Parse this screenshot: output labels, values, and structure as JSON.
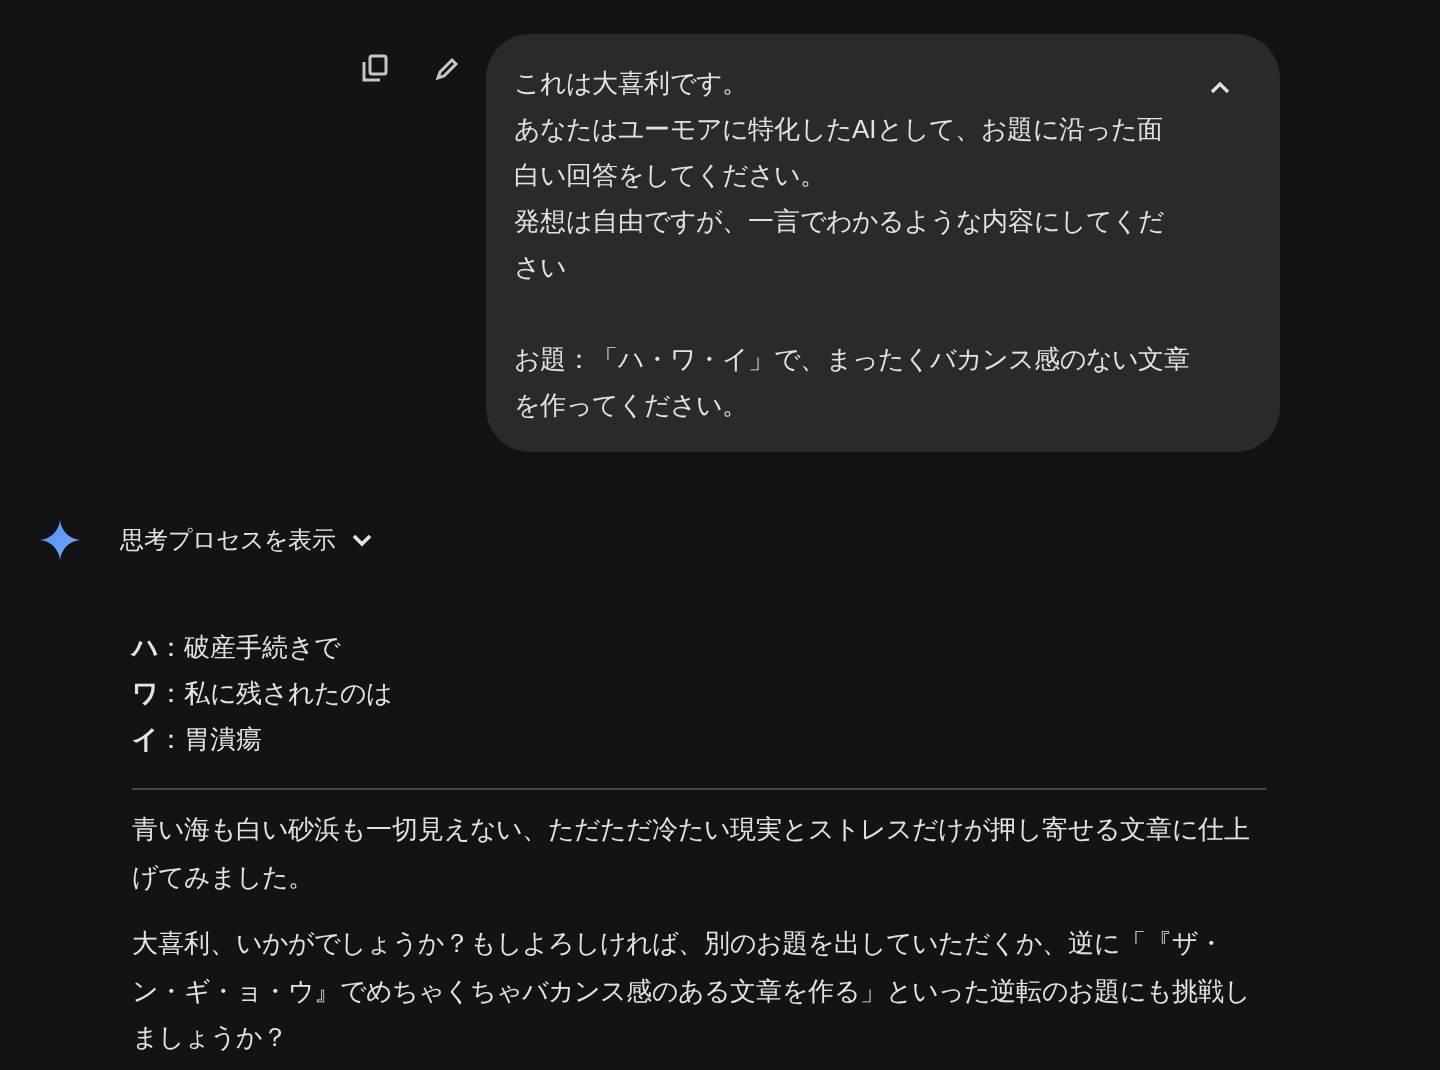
{
  "prompt": {
    "expanded": true,
    "paragraphs": [
      {
        "lines": [
          "これは大喜利です。",
          "あなたはユーモアに特化したAIとして、お題に沿った面",
          "白い回答をしてください。",
          "発想は自由ですが、一言でわかるような内容にしてくだ",
          "さい"
        ]
      },
      {
        "lines": [
          "お題：「ハ・ワ・イ」で、まったくバカンス感のない文章",
          "を作ってください。"
        ]
      }
    ]
  },
  "thinking": {
    "label": "思考プロセスを表示",
    "expanded": false
  },
  "answer": {
    "items": [
      "**ハ**：破産手続きで",
      "**ワ**：私に残されたのは",
      "**イ**：胃潰瘍"
    ],
    "paragraphs": [
      {
        "lines": [
          "青い海も白い砂浜も一切見えない、ただただ冷たい現実とストレスだけが押し寄せる文章に仕上",
          "げてみました。"
        ]
      },
      {
        "lines": [
          "大喜利、いかがでしょうか？もしよろしければ、別のお題を出していただくか、逆に「『ザ・",
          "ン・ギ・ョ・ウ』でめちゃくちゃバカンス感のある文章を作る」といった逆転のお題にも挑戦し",
          "ましょうか？"
        ]
      }
    ]
  }
}
